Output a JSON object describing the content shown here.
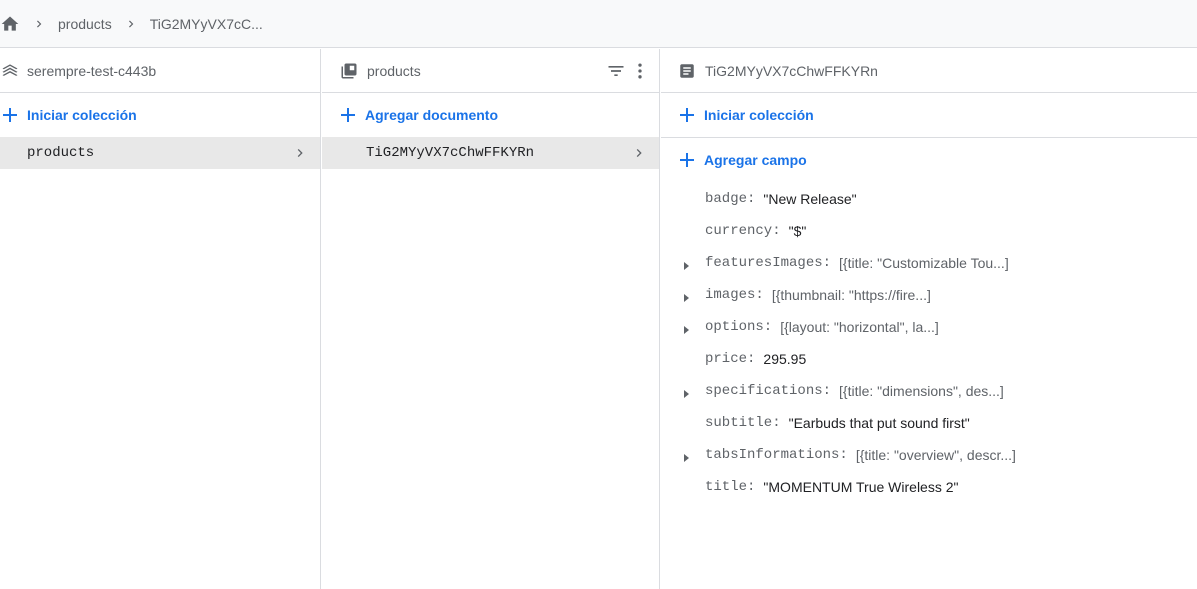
{
  "breadcrumb": {
    "items": [
      "products",
      "TiG2MYyVX7cC..."
    ]
  },
  "project_panel": {
    "title": "serempre-test-c443b",
    "action_label": "Iniciar colección",
    "items": [
      {
        "label": "products"
      }
    ]
  },
  "collection_panel": {
    "title": "products",
    "action_label": "Agregar documento",
    "items": [
      {
        "label": "TiG2MYyVX7cChwFFKYRn"
      }
    ]
  },
  "document_panel": {
    "title": "TiG2MYyVX7cChwFFKYRn",
    "start_collection_label": "Iniciar colección",
    "add_field_label": "Agregar campo",
    "fields": [
      {
        "key": "badge:",
        "value": "\"New Release\"",
        "expandable": false
      },
      {
        "key": "currency:",
        "value": "\"$\"",
        "expandable": false
      },
      {
        "key": "featuresImages:",
        "value": "[{title: \"Customizable Tou...]",
        "expandable": true
      },
      {
        "key": "images:",
        "value": "[{thumbnail: \"https://fire...]",
        "expandable": true
      },
      {
        "key": "options:",
        "value": "[{layout: \"horizontal\", la...]",
        "expandable": true
      },
      {
        "key": "price:",
        "value": "295.95",
        "expandable": false
      },
      {
        "key": "specifications:",
        "value": "[{title: \"dimensions\", des...]",
        "expandable": true
      },
      {
        "key": "subtitle:",
        "value": "\"Earbuds that put sound first\"",
        "expandable": false
      },
      {
        "key": "tabsInformations:",
        "value": "[{title: \"overview\", descr...]",
        "expandable": true
      },
      {
        "key": "title:",
        "value": "\"MOMENTUM True Wireless 2\"",
        "expandable": false
      }
    ]
  },
  "colors": {
    "accent": "#1a73e8",
    "text_primary": "#202124",
    "text_secondary": "#5f6368",
    "selected_row": "#e8e8e8",
    "divider": "#dadce0",
    "breadcrumb_bg": "#f8f9fa"
  },
  "icons": {
    "home": "home-icon",
    "breadcrumb_sep": "chevron-right-icon",
    "project": "firebase-project-icon",
    "collection": "collection-icon",
    "filter": "filter-icon",
    "more": "more-vert-icon",
    "document": "document-icon",
    "add": "plus-icon",
    "expand": "expand-triangle-icon"
  }
}
